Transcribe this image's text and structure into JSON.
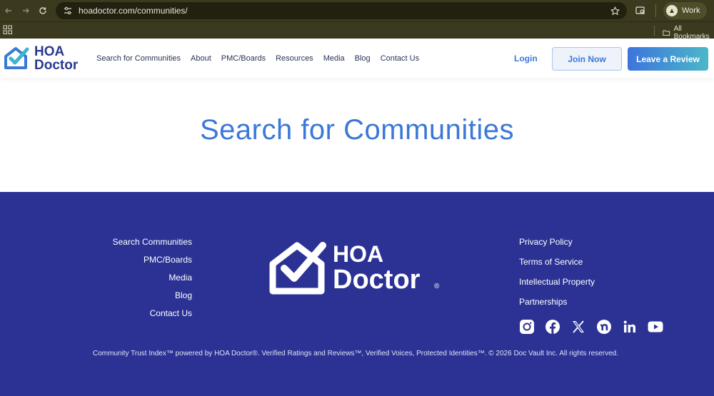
{
  "browser": {
    "url": "hoadoctor.com/communities/",
    "profile_name": "Work",
    "bookmarks_label": "All Bookmarks"
  },
  "header": {
    "logo_line1": "HOA",
    "logo_line2": "Doctor",
    "nav": [
      "Search for Communities",
      "About",
      "PMC/Boards",
      "Resources",
      "Media",
      "Blog",
      "Contact Us"
    ],
    "login_label": "Login",
    "join_label": "Join Now",
    "review_label": "Leave a Review"
  },
  "hero": {
    "title": "Search for Communities"
  },
  "footer": {
    "left_links": [
      "Search Communities",
      "PMC/Boards",
      "Media",
      "Blog",
      "Contact Us"
    ],
    "logo_line1": "HOA",
    "logo_line2": "Doctor",
    "logo_reg": "®",
    "right_links": [
      "Privacy Policy",
      "Terms of Service",
      "Intellectual Property",
      "Partnerships"
    ],
    "socials": [
      "instagram-icon",
      "facebook-icon",
      "x-icon",
      "nextdoor-icon",
      "linkedin-icon",
      "youtube-icon"
    ],
    "copyright": "Community Trust Index™ powered by HOA Doctor®. Verified Ratings and Reviews™, Verified Voices, Protected Identities™. © 2026 Doc Vault Inc. All rights reserved."
  },
  "colors": {
    "brand_blue": "#3b78d8",
    "brand_navy": "#2a3a8f",
    "footer_bg": "#2b3294",
    "chrome_bg": "#3b3a1f"
  }
}
